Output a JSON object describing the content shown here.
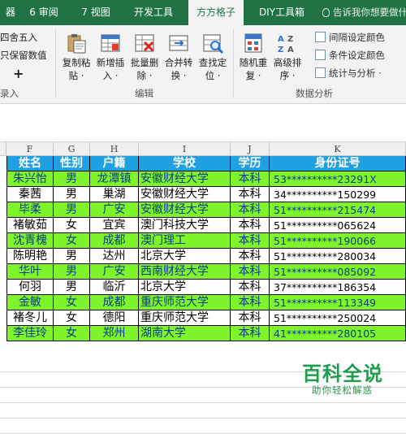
{
  "tabs": [
    {
      "label": "器"
    },
    {
      "label": "6 审阅"
    },
    {
      "label": "7 视图"
    },
    {
      "label": "开发工具"
    },
    {
      "label": "方方格子"
    },
    {
      "label": "DIY工具箱"
    }
  ],
  "tell_me": "告诉我你想要做什么",
  "ribbon": {
    "left": {
      "round": "四舍五入",
      "keep": "只保留数值",
      "plus": "+",
      "entry": "录入"
    },
    "buttons": [
      {
        "name": "copy-paste",
        "line1": "复制粘",
        "line2": "贴 ·"
      },
      {
        "name": "insert",
        "line1": "新增插",
        "line2": "入 ·"
      },
      {
        "name": "batch-delete",
        "line1": "批量删",
        "line2": "除 ·"
      },
      {
        "name": "merge-convert",
        "line1": "合并转",
        "line2": "换 ·"
      },
      {
        "name": "find-locate",
        "line1": "查找定",
        "line2": "位 ·"
      },
      {
        "name": "random",
        "line1": "随机重",
        "line2": "复 ·"
      },
      {
        "name": "sort",
        "line1": "高级排",
        "line2": "序 ·"
      }
    ],
    "edit_group": "编辑",
    "analysis_group": "数据分析",
    "small": {
      "interval": "间隔设定颜色",
      "condition": "条件设定颜色",
      "stats": "统计与分析 ·"
    }
  },
  "columns": [
    "F",
    "G",
    "H",
    "I",
    "J",
    "K"
  ],
  "table": {
    "headers": [
      "姓名",
      "性别",
      "户籍",
      "学校",
      "学历",
      "身份证号"
    ],
    "rows": [
      {
        "name": "朱兴怡",
        "gender": "男",
        "origin": "龙潭镇",
        "school": "安徽财经大学",
        "edu": "本科",
        "id": "53**********23291X",
        "hl": true
      },
      {
        "name": "秦茜",
        "gender": "男",
        "origin": "巢湖",
        "school": "安徽财经大学",
        "edu": "本科",
        "id": "34**********150299",
        "hl": false
      },
      {
        "name": "毕柔",
        "gender": "男",
        "origin": "广安",
        "school": "安徽财经大学",
        "edu": "本科",
        "id": "51**********215474",
        "hl": true
      },
      {
        "name": "褚敏茹",
        "gender": "女",
        "origin": "宜宾",
        "school": "澳门科技大学",
        "edu": "本科",
        "id": "51**********065624",
        "hl": false
      },
      {
        "name": "沈青槐",
        "gender": "女",
        "origin": "成都",
        "school": "澳门理工",
        "edu": "本科",
        "id": "51**********190066",
        "hl": true
      },
      {
        "name": "陈明艳",
        "gender": "男",
        "origin": "达州",
        "school": "北京大学",
        "edu": "本科",
        "id": "51**********280034",
        "hl": false
      },
      {
        "name": "华叶",
        "gender": "男",
        "origin": "广安",
        "school": "西南财经大学",
        "edu": "本科",
        "id": "51**********085092",
        "hl": true
      },
      {
        "name": "何羽",
        "gender": "男",
        "origin": "临沂",
        "school": "北京大学",
        "edu": "本科",
        "id": "37**********186354",
        "hl": false
      },
      {
        "name": "金敏",
        "gender": "女",
        "origin": "成都",
        "school": "重庆师范大学",
        "edu": "本科",
        "id": "51**********113349",
        "hl": true
      },
      {
        "name": "褚冬儿",
        "gender": "女",
        "origin": "德阳",
        "school": "重庆师范大学",
        "edu": "本科",
        "id": "51**********250024",
        "hl": false
      },
      {
        "name": "李佳玲",
        "gender": "女",
        "origin": "郑州",
        "school": "湖南大学",
        "edu": "本科",
        "id": "41**********280105",
        "hl": true
      }
    ]
  },
  "watermark": {
    "big": "百科全说",
    "small": "助你轻松解惑"
  },
  "colors": {
    "excel_green": "#217346",
    "header_blue": "#1fa0e2",
    "highlight_green": "#7df52a"
  }
}
